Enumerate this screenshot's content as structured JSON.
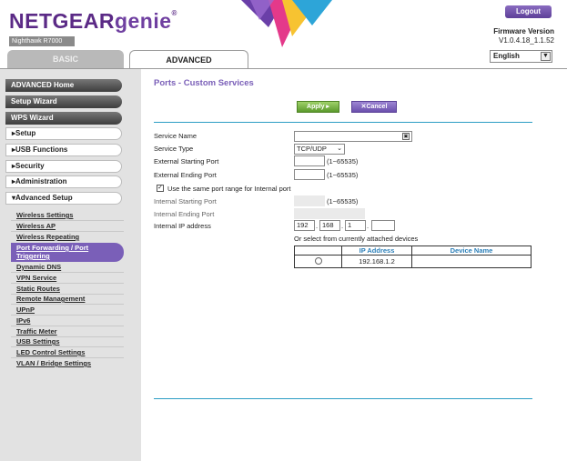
{
  "header": {
    "brand": "NETGEAR",
    "brand_product": "genie",
    "brand_mark": "®",
    "model": "Nighthawk R7000",
    "logout_label": "Logout",
    "firmware_label": "Firmware Version",
    "firmware_value": "V1.0.4.18_1.1.52",
    "language": "English"
  },
  "tabs": [
    {
      "label": "BASIC"
    },
    {
      "label": "ADVANCED"
    }
  ],
  "sidebar": {
    "main_items": [
      {
        "label": "ADVANCED Home"
      },
      {
        "label": "Setup Wizard"
      },
      {
        "label": "WPS Wizard"
      }
    ],
    "sections": [
      {
        "label": "▸Setup"
      },
      {
        "label": "▸USB Functions"
      },
      {
        "label": "▸Security"
      },
      {
        "label": "▸Administration"
      },
      {
        "label": "▾Advanced Setup"
      }
    ],
    "sub_items": [
      {
        "label": "Wireless Settings"
      },
      {
        "label": "Wireless AP"
      },
      {
        "label": "Wireless Repeating"
      },
      {
        "label": "Port Forwarding / Port Triggering"
      },
      {
        "label": "Dynamic DNS"
      },
      {
        "label": "VPN Service"
      },
      {
        "label": "Static Routes"
      },
      {
        "label": "Remote Management"
      },
      {
        "label": "UPnP"
      },
      {
        "label": "IPv6"
      },
      {
        "label": "Traffic Meter"
      },
      {
        "label": "USB Settings"
      },
      {
        "label": "LED Control Settings"
      },
      {
        "label": "VLAN / Bridge Settings"
      }
    ]
  },
  "main": {
    "title": "Ports - Custom Services",
    "apply_label": "Apply ▸",
    "cancel_label": "✕Cancel",
    "form": {
      "service_name_label": "Service Name",
      "service_name_value": "",
      "service_type_label": "Service Type",
      "service_type_value": "TCP/UDP",
      "ext_start_label": "External Starting Port",
      "ext_start_value": "",
      "ext_end_label": "External Ending Port",
      "ext_end_value": "",
      "port_range_hint": "(1~65535)",
      "same_range_label": "Use the same port range for Internal port",
      "same_range_checked": "✓",
      "int_start_label": "Internal Starting Port",
      "int_end_label": "Internal Ending Port",
      "int_ip_label": "Internal IP address",
      "ip_octets": [
        "192",
        "168",
        "1",
        ""
      ],
      "select_hint": "Or select from currently attached devices"
    },
    "device_table": {
      "headers": [
        "",
        "IP Address",
        "Device Name"
      ],
      "rows": [
        {
          "ip": "192.168.1.2",
          "name": ""
        }
      ]
    }
  }
}
